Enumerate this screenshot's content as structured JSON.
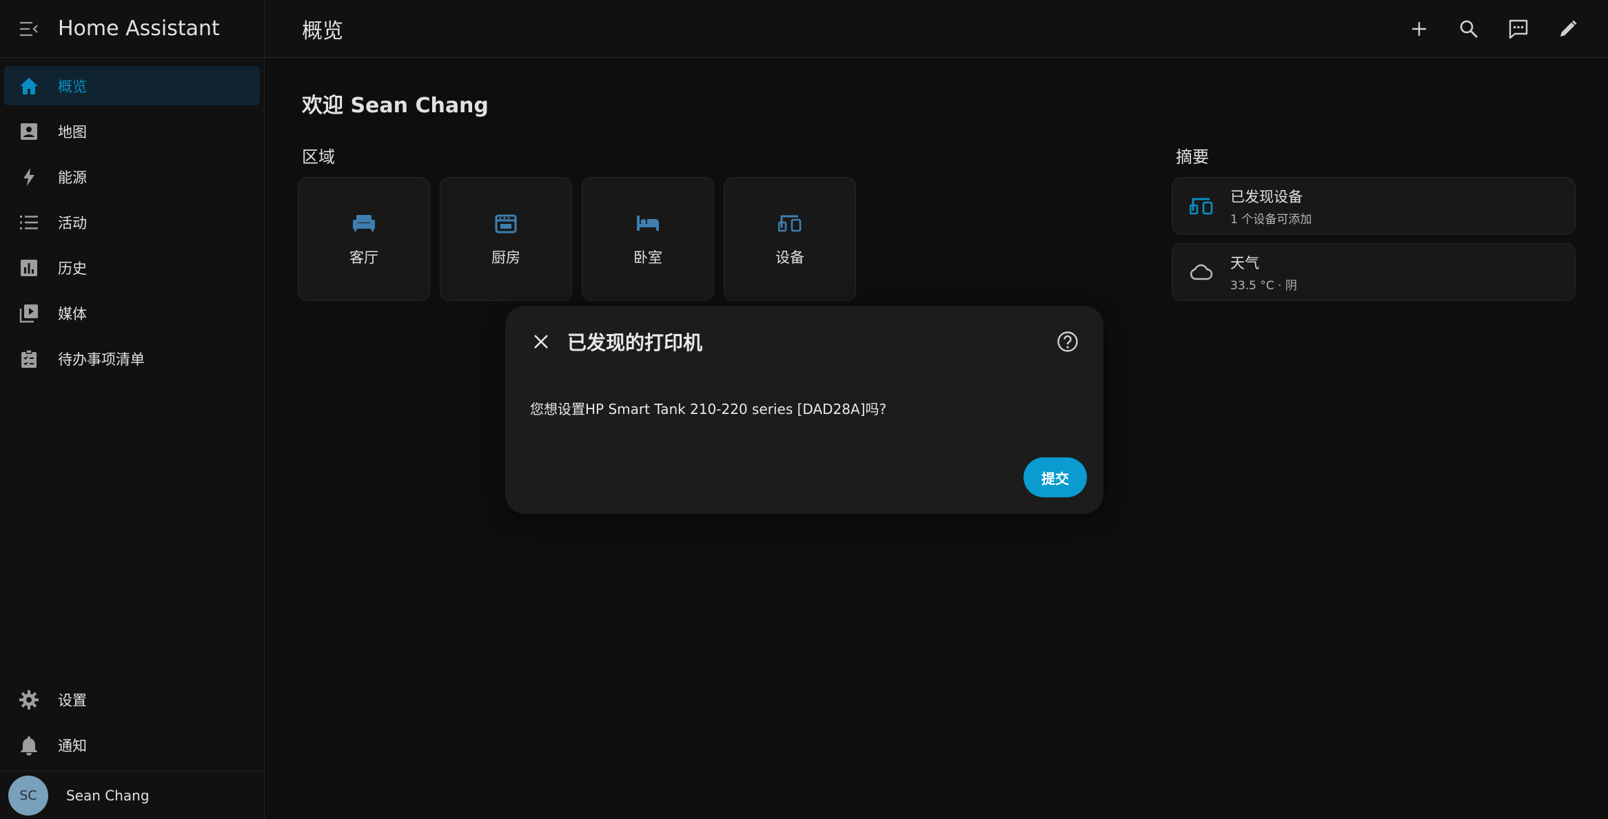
{
  "colors": {
    "accent": "#0a8ec4",
    "area_icon": "#3f7fb0",
    "icon_gray": "#9e9e9e",
    "submit_bg": "#0a9bd0"
  },
  "sidebar": {
    "title": "Home Assistant",
    "items": [
      {
        "label": "概览",
        "icon": "home-icon",
        "active": true
      },
      {
        "label": "地图",
        "icon": "map-icon"
      },
      {
        "label": "能源",
        "icon": "lightning-icon"
      },
      {
        "label": "活动",
        "icon": "list-icon"
      },
      {
        "label": "历史",
        "icon": "chart-icon"
      },
      {
        "label": "媒体",
        "icon": "media-icon"
      },
      {
        "label": "待办事项清单",
        "icon": "clipboard-icon"
      }
    ],
    "bottom_items": [
      {
        "label": "设置",
        "icon": "gear-icon"
      },
      {
        "label": "通知",
        "icon": "bell-icon"
      }
    ],
    "user": {
      "initials": "SC",
      "name": "Sean Chang"
    }
  },
  "header": {
    "title": "概览",
    "actions": [
      "plus-icon",
      "search-icon",
      "assist-icon",
      "pencil-icon"
    ]
  },
  "main": {
    "welcome": "欢迎 Sean Chang",
    "areas_title": "区域",
    "areas": [
      {
        "label": "客厅",
        "icon": "sofa-icon"
      },
      {
        "label": "厨房",
        "icon": "stove-icon"
      },
      {
        "label": "卧室",
        "icon": "bed-icon"
      },
      {
        "label": "设备",
        "icon": "devices-icon"
      }
    ],
    "summary_title": "摘要",
    "summary": [
      {
        "title": "已发现设备",
        "subtitle": "1 个设备可添加",
        "icon": "devices-icon"
      },
      {
        "title": "天气",
        "subtitle": "33.5 °C · 阴",
        "icon": "cloud-icon"
      }
    ]
  },
  "dialog": {
    "title": "已发现的打印机",
    "body": "您想设置HP Smart Tank 210-220 series [DAD28A]吗?",
    "submit": "提交"
  }
}
